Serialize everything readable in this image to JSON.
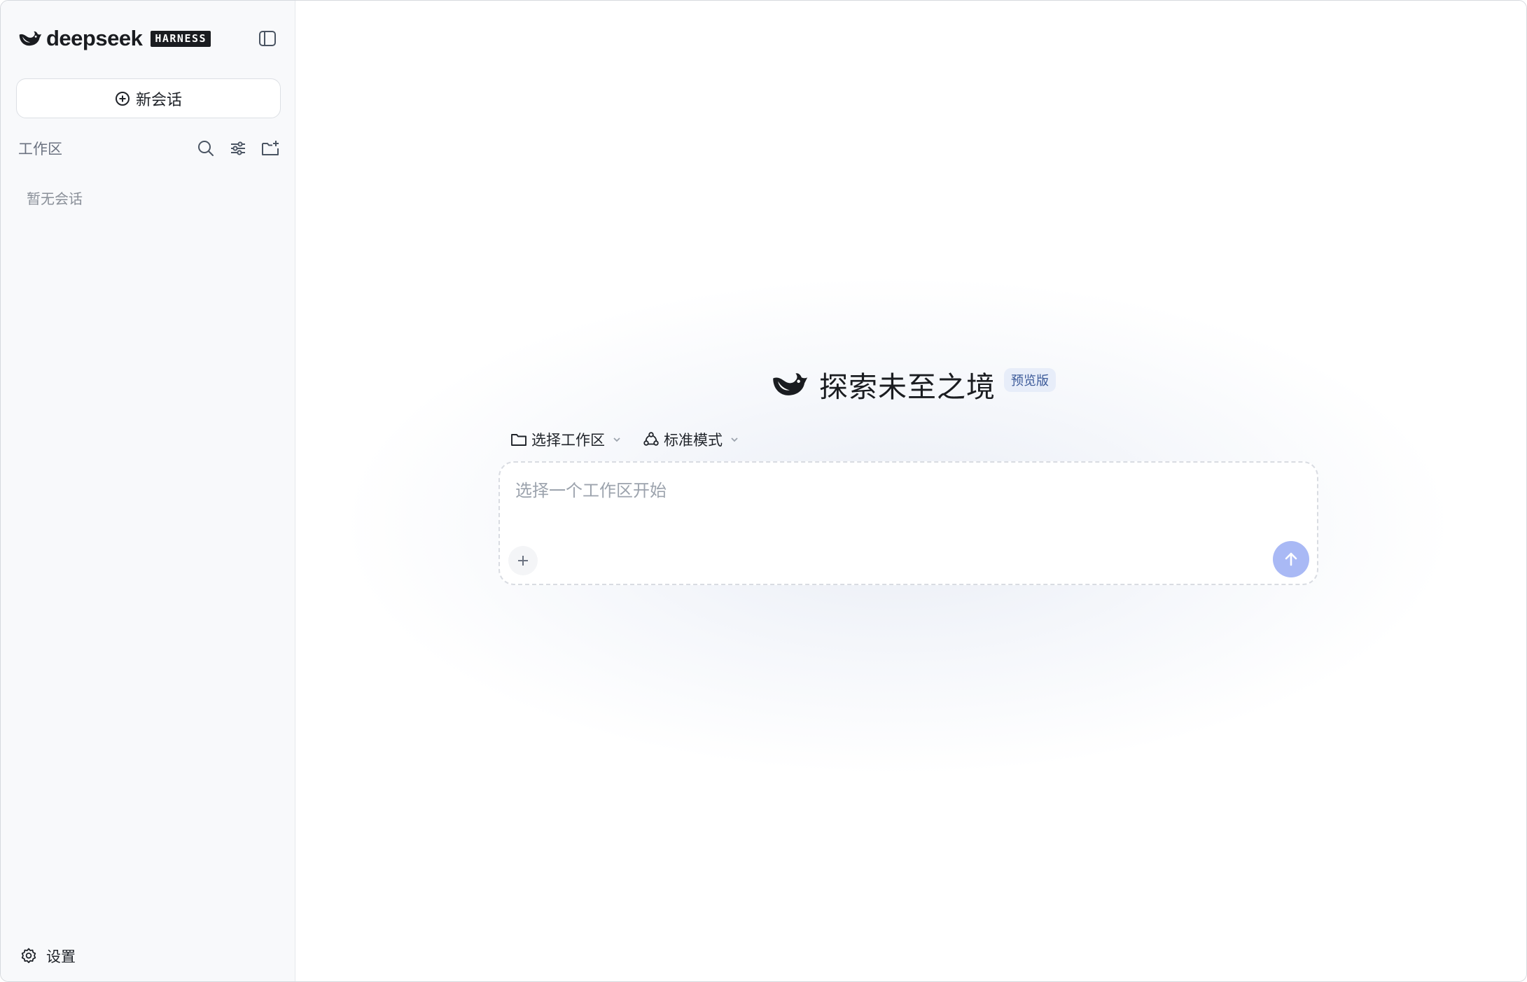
{
  "sidebar": {
    "brand_name": "deepseek",
    "brand_badge": "HARNESS",
    "new_chat_label": "新会话",
    "workspace_label": "工作区",
    "empty_text": "暂无会话",
    "settings_label": "设置",
    "icons": [
      "whale-logo-icon",
      "sidebar-toggle-icon",
      "plus-circle-icon",
      "search-icon",
      "sliders-icon",
      "new-folder-icon",
      "gear-icon"
    ]
  },
  "main": {
    "title": "探索未至之境",
    "badge": "预览版",
    "workspace_select_label": "选择工作区",
    "mode_select_label": "标准模式",
    "input_placeholder": "选择一个工作区开始",
    "input_value": "",
    "icons": [
      "whale-logo-icon",
      "folder-icon",
      "mode-icon",
      "chevron-down-icon",
      "plus-icon",
      "arrow-up-icon"
    ]
  },
  "colors": {
    "sidebar_bg": "#f8f9fb",
    "send_button": "#a9b9f5",
    "badge_bg": "#e7edf9",
    "badge_text": "#3c5a99"
  }
}
